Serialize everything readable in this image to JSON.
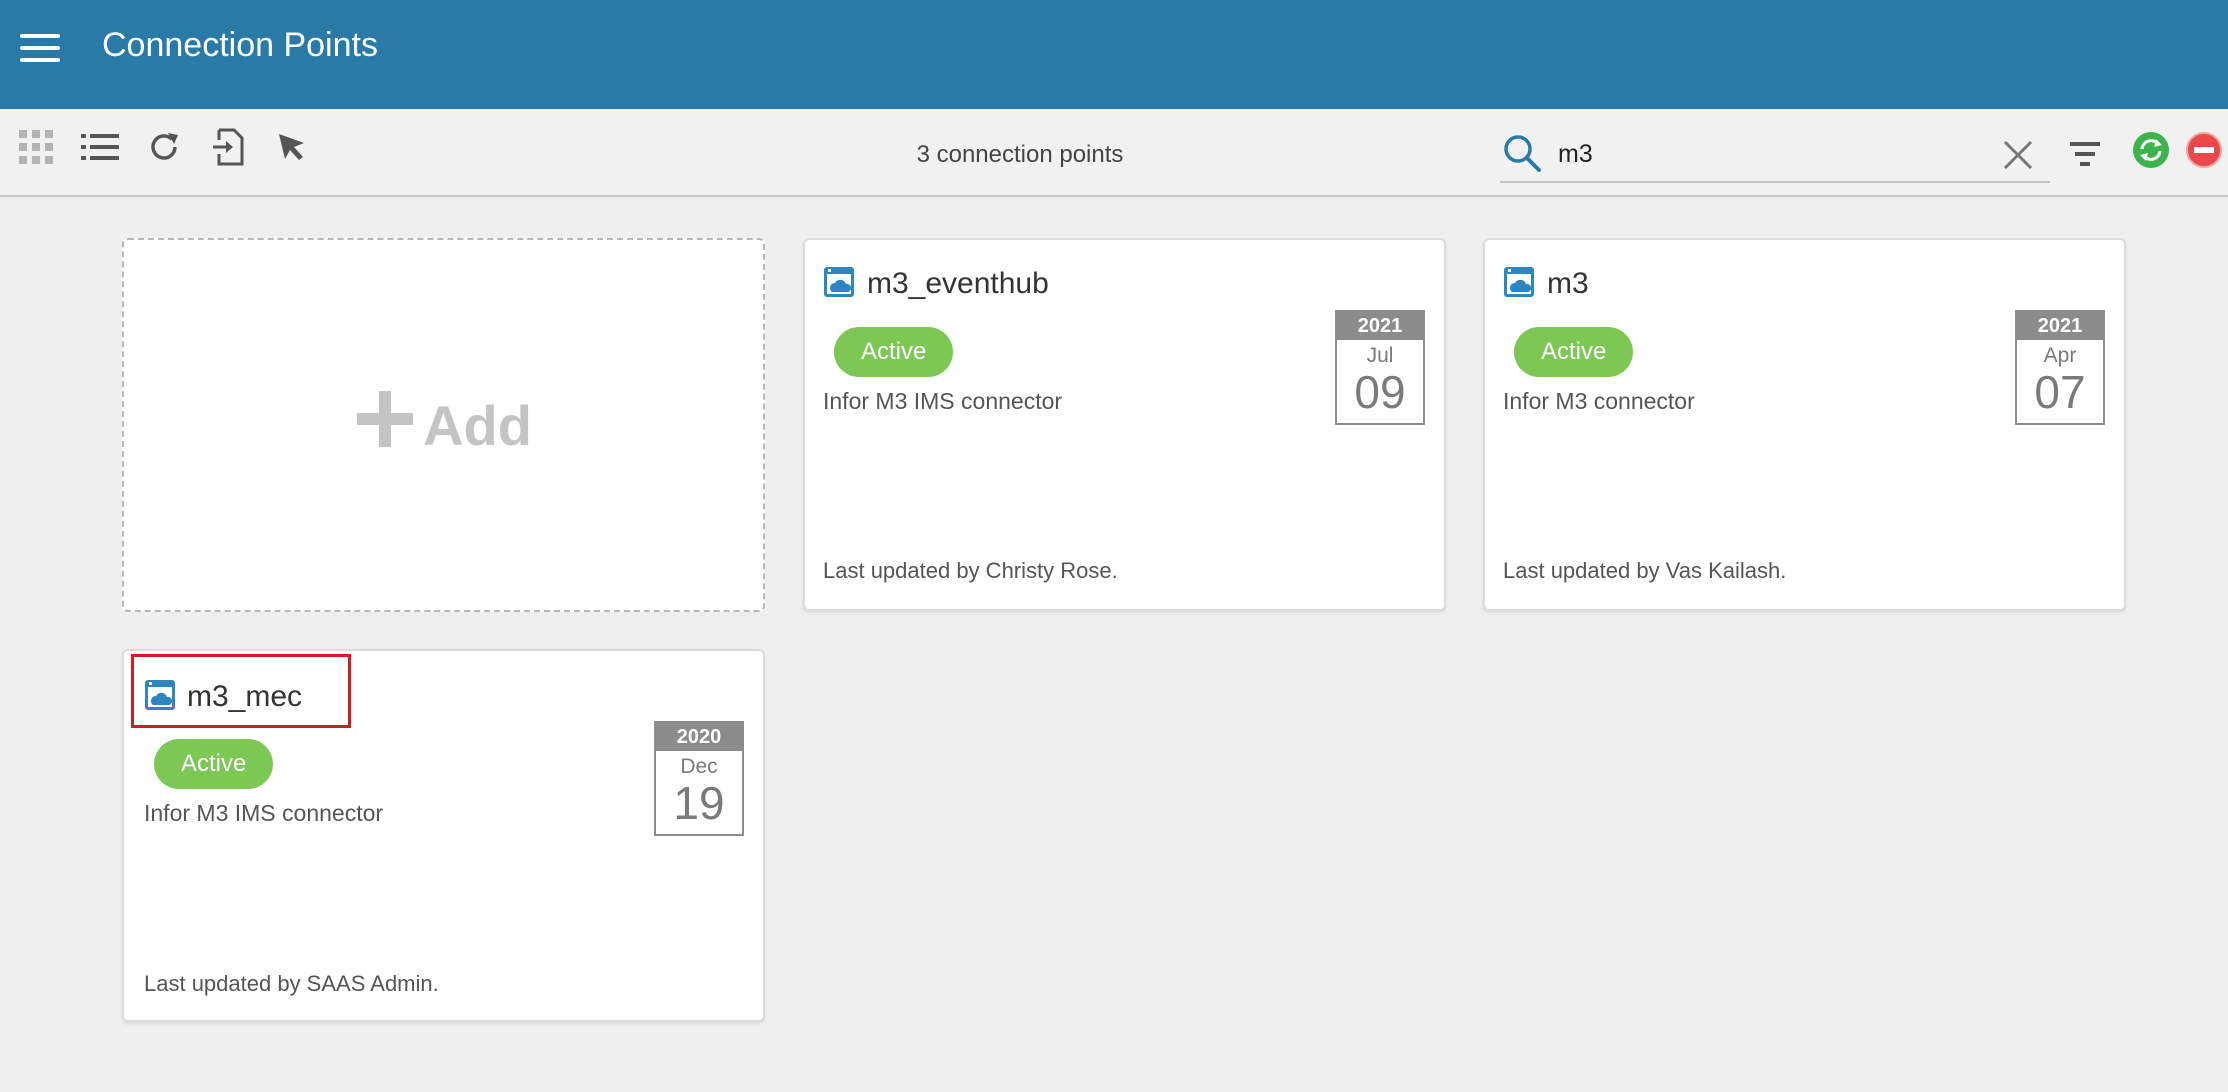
{
  "header": {
    "title": "Connection Points"
  },
  "toolbar": {
    "count_text": "3 connection points",
    "search_value": "m3"
  },
  "add_card": {
    "label": "Add"
  },
  "cards": [
    {
      "name": "m3_eventhub",
      "status": "Active",
      "description": "Infor M3 IMS connector",
      "date": {
        "year": "2021",
        "month": "Jul",
        "day": "09"
      },
      "updated": "Last updated by Christy Rose."
    },
    {
      "name": "m3",
      "status": "Active",
      "description": "Infor M3 connector",
      "date": {
        "year": "2021",
        "month": "Apr",
        "day": "07"
      },
      "updated": "Last updated by Vas Kailash."
    },
    {
      "name": "m3_mec",
      "status": "Active",
      "description": "Infor M3 IMS connector",
      "date": {
        "year": "2020",
        "month": "Dec",
        "day": "19"
      },
      "updated": "Last updated by SAAS Admin."
    }
  ],
  "colors": {
    "header_bg": "#2a7aa8",
    "active_badge": "#7dc855",
    "highlight": "#cc1f1f",
    "sync_green": "#3cb44b",
    "stop_red": "#e84a4a"
  },
  "icons": {
    "menu": "hamburger-menu-icon",
    "grid_view": "grid-view-icon",
    "list_view": "list-view-icon",
    "refresh": "refresh-icon",
    "import": "import-icon",
    "select": "cursor-select-icon",
    "search": "search-icon",
    "clear": "clear-icon",
    "filter": "filter-icon",
    "sync": "sync-icon",
    "stop": "stop-icon",
    "connection": "cloud-window-icon"
  }
}
